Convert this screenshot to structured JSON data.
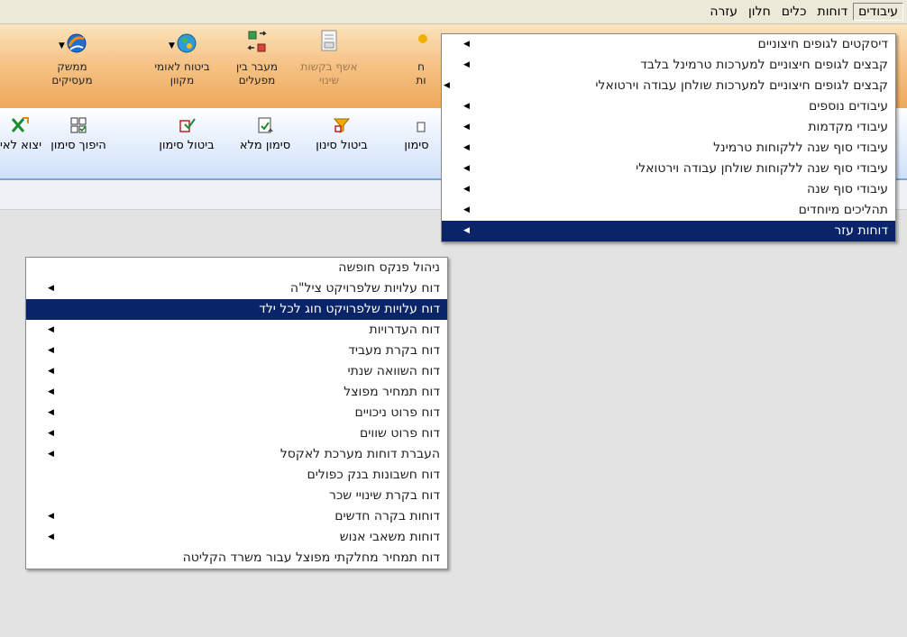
{
  "menubar": {
    "items": [
      {
        "label": "עיבודים",
        "active": true
      },
      {
        "label": "דוחות",
        "active": false
      },
      {
        "label": "כלים",
        "active": false
      },
      {
        "label": "חלון",
        "active": false
      },
      {
        "label": "עזרה",
        "active": false
      }
    ]
  },
  "ribbon": {
    "buttons": [
      {
        "line1": "ממשק",
        "line2": "מעסיקים",
        "icon": "globe-swirl-icon",
        "dropdown": true
      },
      {
        "line1": "ביטוח לאומי",
        "line2": "מקוון",
        "icon": "globe-people-icon",
        "dropdown": true
      },
      {
        "line1": "מעבר בין",
        "line2": "מפעלים",
        "icon": "factory-transfer-icon",
        "dropdown": false
      },
      {
        "line1": "אשף בקשות",
        "line2": "שינוי",
        "icon": "wizard-form-icon",
        "dropdown": false,
        "disabled": true
      },
      {
        "line1": "ח",
        "line2": "ות",
        "icon": "partial-icon",
        "dropdown": false
      }
    ]
  },
  "toolbar": {
    "buttons": [
      {
        "label": "יצוא לאי",
        "icon": "excel-export-icon"
      },
      {
        "label": "היפוך סימון",
        "icon": "invert-selection-icon"
      },
      {
        "label": "ביטול סימון",
        "icon": "uncheck-icon"
      },
      {
        "label": "סימון מלא",
        "icon": "check-all-icon"
      },
      {
        "label": "ביטול סינון",
        "icon": "clear-filter-icon"
      },
      {
        "label": "סימון",
        "icon": "partial-mark-icon"
      }
    ]
  },
  "main_menu": {
    "items": [
      {
        "label": "דיסקטים לגופים חיצוניים",
        "submenu": true,
        "selected": false
      },
      {
        "label": "קבצים לגופים חיצוניים למערכות טרמינל בלבד",
        "submenu": true,
        "selected": false
      },
      {
        "label": "קבצים לגופים חיצוניים למערכות שולחן עבודה וירטואלי",
        "submenu": true,
        "selected": false
      },
      {
        "label": "עיבודים נוספים",
        "submenu": true,
        "selected": false
      },
      {
        "label": "עיבודי מקדמות",
        "submenu": true,
        "selected": false
      },
      {
        "label": "עיבודי סוף שנה ללקוחות טרמינל",
        "submenu": true,
        "selected": false
      },
      {
        "label": "עיבודי סוף שנה ללקוחות שולחן עבודה וירטואלי",
        "submenu": true,
        "selected": false
      },
      {
        "label": "עיבודי סוף שנה",
        "submenu": true,
        "selected": false
      },
      {
        "label": "תהליכים מיוחדים",
        "submenu": true,
        "selected": false
      },
      {
        "label": "דוחות עזר",
        "submenu": true,
        "selected": true
      }
    ]
  },
  "sub_menu": {
    "items": [
      {
        "label": "ניהול פנקס חופשה",
        "submenu": false,
        "selected": false
      },
      {
        "label": "דוח עלויות שלפרויקט ציל\"ה",
        "submenu": true,
        "selected": false
      },
      {
        "label": "דוח עלויות שלפרויקט חוג לכל ילד",
        "submenu": false,
        "selected": true
      },
      {
        "label": "דוח העדרויות",
        "submenu": true,
        "selected": false
      },
      {
        "label": "דוח בקרת מעביד",
        "submenu": true,
        "selected": false
      },
      {
        "label": "דוח השוואה שנתי",
        "submenu": true,
        "selected": false
      },
      {
        "label": "דוח תמחיר מפוצל",
        "submenu": true,
        "selected": false
      },
      {
        "label": "דוח פרוט ניכויים",
        "submenu": true,
        "selected": false
      },
      {
        "label": "דוח פרוט שווים",
        "submenu": true,
        "selected": false
      },
      {
        "label": "העברת דוחות מערכת לאקסל",
        "submenu": true,
        "selected": false
      },
      {
        "label": "דוח חשבונות בנק כפולים",
        "submenu": false,
        "selected": false
      },
      {
        "label": "דוח בקרת שינויי שכר",
        "submenu": false,
        "selected": false
      },
      {
        "label": "דוחות בקרה חדשים",
        "submenu": true,
        "selected": false
      },
      {
        "label": "דוחות משאבי אנוש",
        "submenu": true,
        "selected": false
      },
      {
        "label": "דוח תמחיר מחלקתי מפוצל עבור משרד הקליטה",
        "submenu": false,
        "selected": false
      }
    ]
  }
}
